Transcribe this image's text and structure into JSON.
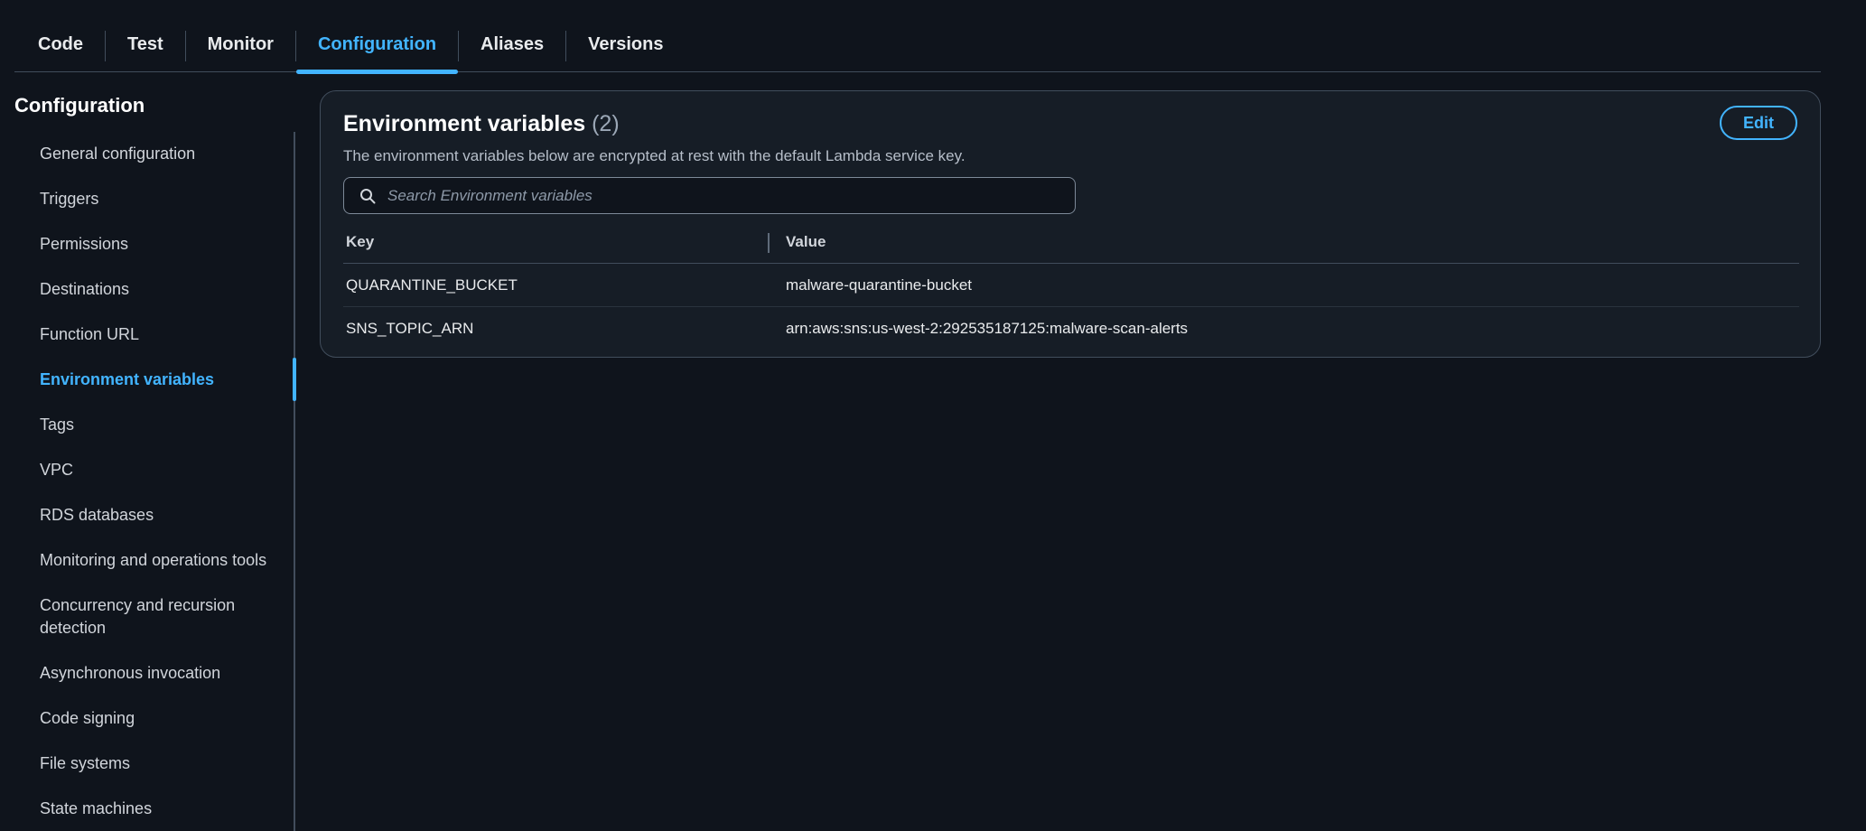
{
  "tabs": [
    {
      "label": "Code",
      "active": false
    },
    {
      "label": "Test",
      "active": false
    },
    {
      "label": "Monitor",
      "active": false
    },
    {
      "label": "Configuration",
      "active": true
    },
    {
      "label": "Aliases",
      "active": false
    },
    {
      "label": "Versions",
      "active": false
    }
  ],
  "sidebar": {
    "title": "Configuration",
    "items": [
      {
        "label": "General configuration"
      },
      {
        "label": "Triggers"
      },
      {
        "label": "Permissions"
      },
      {
        "label": "Destinations"
      },
      {
        "label": "Function URL"
      },
      {
        "label": "Environment variables"
      },
      {
        "label": "Tags"
      },
      {
        "label": "VPC"
      },
      {
        "label": "RDS databases"
      },
      {
        "label": "Monitoring and operations tools"
      },
      {
        "label": "Concurrency and recursion detection"
      },
      {
        "label": "Asynchronous invocation"
      },
      {
        "label": "Code signing"
      },
      {
        "label": "File systems"
      },
      {
        "label": "State machines"
      }
    ],
    "active_index": 5
  },
  "panel": {
    "title": "Environment variables",
    "count": "(2)",
    "description": "The environment variables below are encrypted at rest with the default Lambda service key.",
    "edit_label": "Edit",
    "search": {
      "placeholder": "Search Environment variables",
      "value": ""
    },
    "table": {
      "headers": {
        "key": "Key",
        "value": "Value"
      },
      "rows": [
        {
          "key": "QUARANTINE_BUCKET",
          "value": "malware-quarantine-bucket"
        },
        {
          "key": "SNS_TOPIC_ARN",
          "value": "arn:aws:sns:us-west-2:292535187125:malware-scan-alerts"
        }
      ]
    }
  },
  "colors": {
    "background": "#0f141c",
    "panel": "#161d26",
    "accent": "#42b4ff",
    "border": "#414d5c"
  },
  "icons": {
    "search": "search-icon"
  }
}
